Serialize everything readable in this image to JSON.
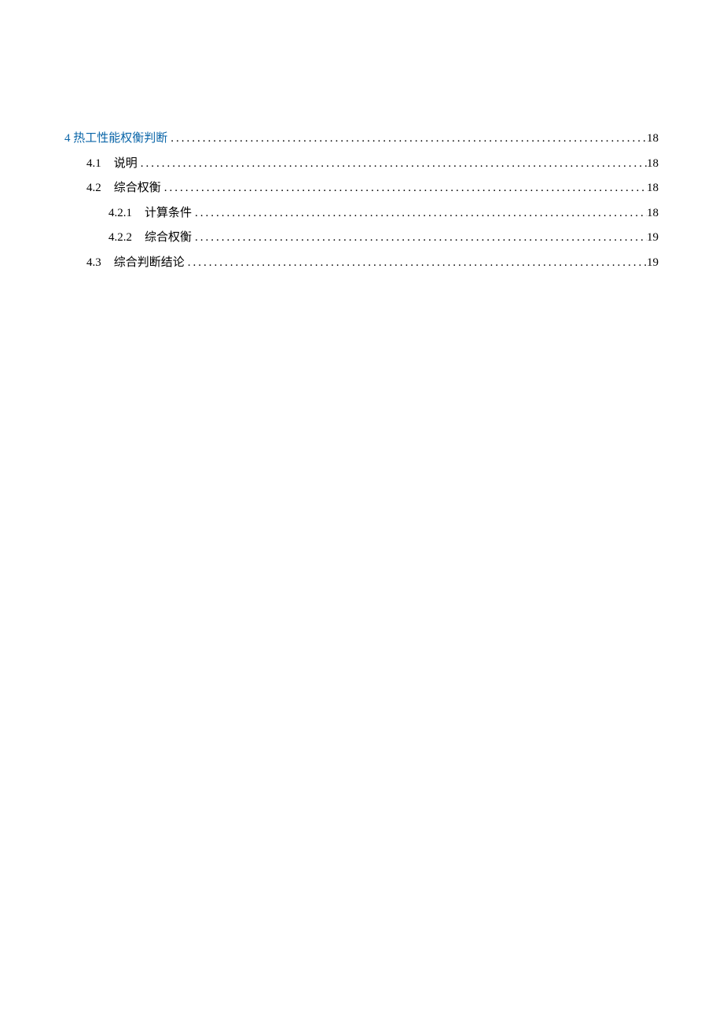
{
  "toc": {
    "entries": [
      {
        "level": 1,
        "number": "4",
        "title": "热工性能权衡判断",
        "page": "18"
      },
      {
        "level": 2,
        "number": "4.1",
        "title": "说明",
        "page": "18"
      },
      {
        "level": 2,
        "number": "4.2",
        "title": "综合权衡",
        "page": "18"
      },
      {
        "level": 3,
        "number": "4.2.1",
        "title": "计算条件",
        "page": "18"
      },
      {
        "level": 3,
        "number": "4.2.2",
        "title": "综合权衡",
        "page": "19"
      },
      {
        "level": 2,
        "number": "4.3",
        "title": "综合判断结论",
        "page": "19"
      }
    ]
  }
}
